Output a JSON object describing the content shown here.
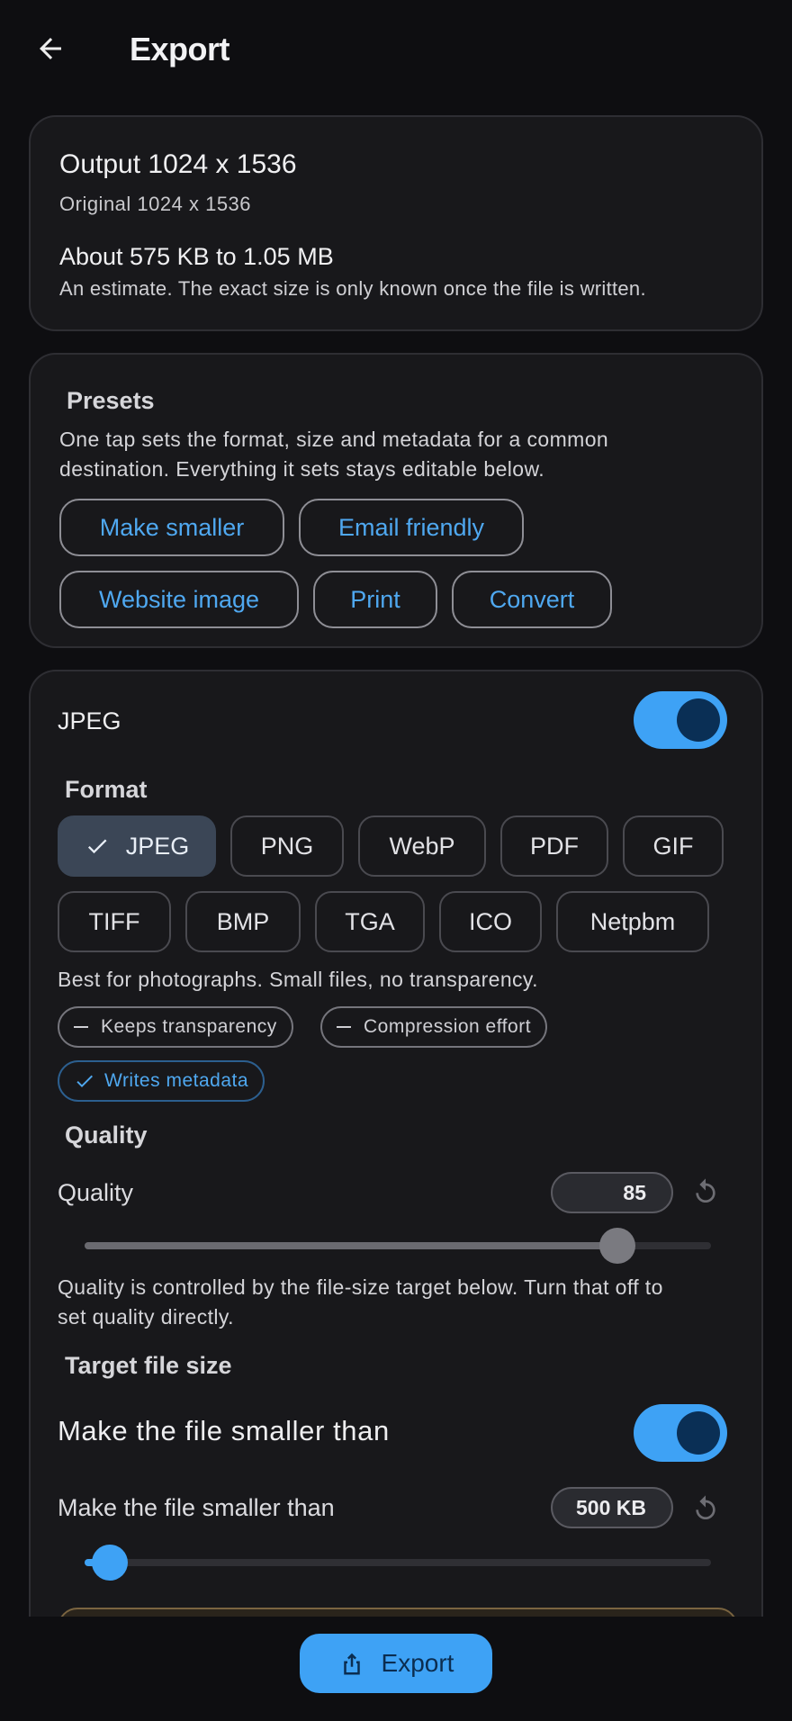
{
  "header": {
    "title": "Export",
    "back_icon": "arrow-left-icon"
  },
  "summary": {
    "output": "Output 1024 x 1536",
    "original": "Original 1024 x 1536",
    "size_estimate": "About 575 KB to 1.05 MB",
    "estimate_note": "An estimate. The exact size is only known once the file is written."
  },
  "presets": {
    "heading": "Presets",
    "description_line1": "One tap sets the format, size and metadata for a common",
    "description_line2": "destination. Everything it sets stays editable below.",
    "buttons": [
      "Make smaller",
      "Email friendly",
      "Website image",
      "Print",
      "Convert"
    ]
  },
  "format_card": {
    "name": "JPEG",
    "enabled": true,
    "format_heading": "Format",
    "formats": [
      "JPEG",
      "PNG",
      "WebP",
      "PDF",
      "GIF",
      "TIFF",
      "BMP",
      "TGA",
      "ICO",
      "Netpbm"
    ],
    "selected_format": "JPEG",
    "format_description": "Best for photographs. Small files, no transparency.",
    "capabilities": [
      {
        "label": "Keeps transparency",
        "supported": false
      },
      {
        "label": "Compression effort",
        "supported": false
      },
      {
        "label": "Writes metadata",
        "supported": true
      }
    ],
    "quality_heading": "Quality",
    "quality_label": "Quality",
    "quality_value": "85",
    "quality_fraction": 0.85,
    "quality_note_line1": "Quality is controlled by the file-size target below. Turn that off to",
    "quality_note_line2": "set quality directly.",
    "target_heading": "Target file size",
    "target_toggle_label": "Make the file smaller than",
    "target_enabled": true,
    "target_label": "Make the file smaller than",
    "target_value": "500 KB",
    "target_fraction": 0.04
  },
  "colors": {
    "accent": "#3ea2f5",
    "link": "#4fa8f0",
    "background": "#0e0e11",
    "card": "#18181b"
  },
  "bottom": {
    "export_label": "Export",
    "export_icon": "share-upload-icon"
  }
}
